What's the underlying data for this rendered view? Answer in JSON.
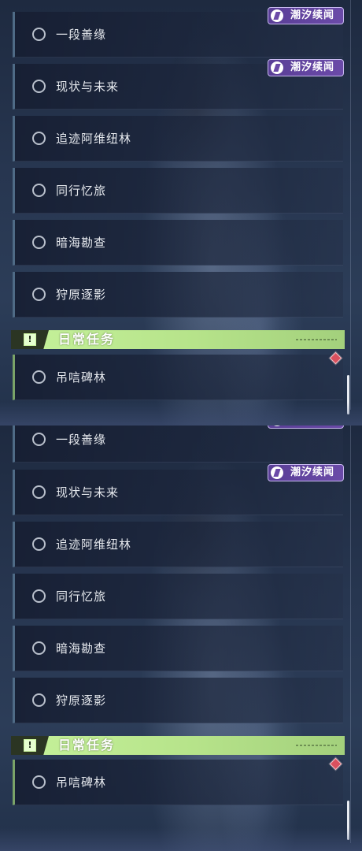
{
  "event_tag": {
    "label": "潮汐续闻",
    "icon": "swirl-emblem-icon",
    "color": "#6b4aa8"
  },
  "quests": [
    {
      "label": "一段善缘"
    },
    {
      "label": "现状与未来"
    },
    {
      "label": "追迹阿维纽林"
    },
    {
      "label": "同行忆旅"
    },
    {
      "label": "暗海勘查"
    },
    {
      "label": "狩原逐影"
    }
  ],
  "daily": {
    "category_label": "日常任务",
    "icon": "exclamation-icon",
    "accent": "#b6e38a",
    "quests": [
      {
        "label": "吊唁碑林"
      }
    ],
    "marker_color": "#d9505e"
  }
}
